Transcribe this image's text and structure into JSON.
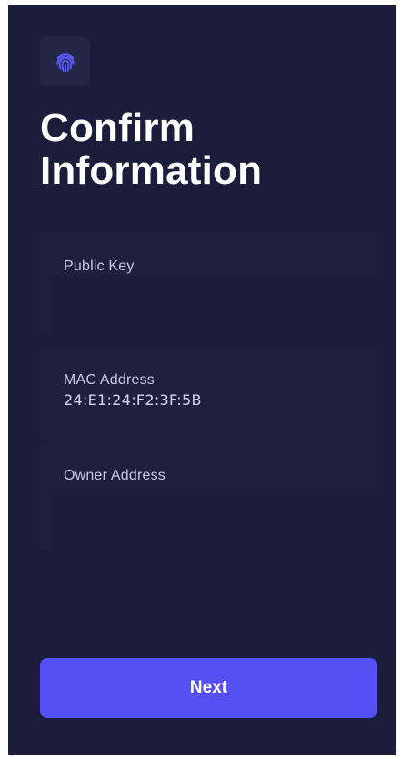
{
  "header": {
    "logo_icon": "fingerprint-icon",
    "title_line1": "Confirm",
    "title_line2": "Information"
  },
  "fields": [
    {
      "label": "Public Key",
      "value": ""
    },
    {
      "label": "MAC Address",
      "value": "24:E1:24:F2:3F:5B"
    },
    {
      "label": "Owner Address",
      "value": ""
    }
  ],
  "footer": {
    "next_label": "Next"
  },
  "colors": {
    "background": "#1b1d3a",
    "card": "#1e2040",
    "accent": "#5550f6",
    "icon": "#5a58ff",
    "text": "#ffffff",
    "label": "#c7c9e6"
  }
}
